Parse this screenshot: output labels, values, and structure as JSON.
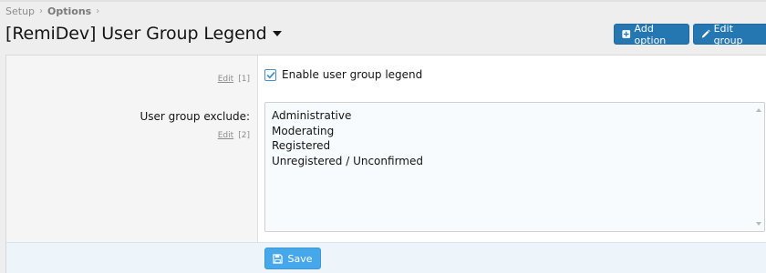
{
  "breadcrumb": {
    "items": [
      "Setup",
      "Options"
    ],
    "separator": "›"
  },
  "header": {
    "title": "[RemiDev] User Group Legend",
    "add_option_label": "Add option",
    "edit_group_label": "Edit group"
  },
  "options": {
    "row1": {
      "edit_label": "Edit",
      "edit_count": "[1]",
      "checkbox_label": "Enable user group legend",
      "checked": true
    },
    "row2": {
      "label": "User group exclude:",
      "edit_label": "Edit",
      "edit_count": "[2]",
      "list_items": [
        "Administrative",
        "Moderating",
        "Registered",
        "Unregistered / Unconfirmed"
      ]
    }
  },
  "footer": {
    "save_label": "Save"
  },
  "colors": {
    "primary_button": "#2577b1",
    "save_button": "#47a7eb",
    "checkbox_accent": "#4a90c8"
  },
  "icons": {
    "add_option": "plus-square-icon",
    "edit_group": "pencil-icon",
    "save": "floppy-disk-icon",
    "title_menu": "caret-down-icon"
  }
}
